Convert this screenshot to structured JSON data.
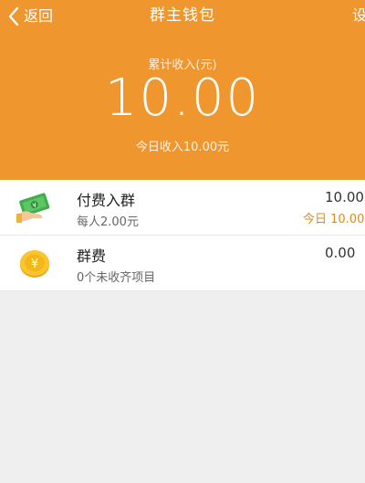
{
  "header": {
    "back_label": "返回",
    "title": "群主钱包",
    "right_label": "设",
    "total_label": "累计收入(元)",
    "total_amount": "10.00",
    "today_label": "今日收入10.00元"
  },
  "list": {
    "items": [
      {
        "icon": "cash-hand-icon",
        "title": "付费入群",
        "subtitle": "每人2.00元",
        "value": "10.00",
        "today": "今日 10.00"
      },
      {
        "icon": "coin-icon",
        "title": "群费",
        "subtitle": "0个未收齐项目",
        "value": "0.00"
      }
    ]
  },
  "colors": {
    "header_bg": "#f0962e",
    "accent_text": "#e08a16",
    "page_bg": "#efefef"
  }
}
